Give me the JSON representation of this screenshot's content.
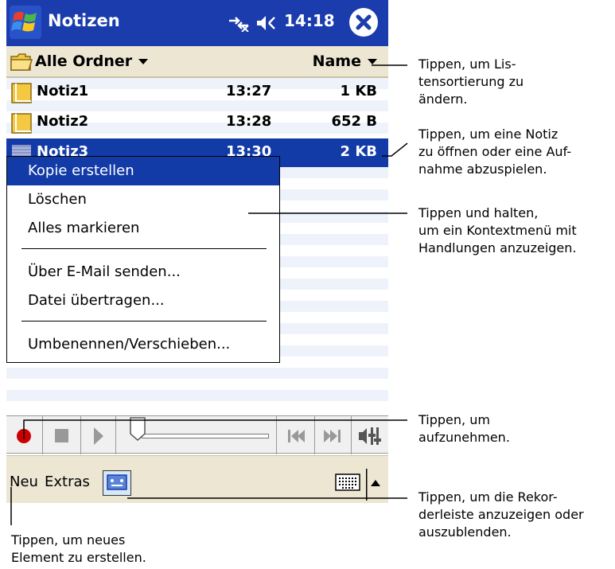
{
  "titlebar": {
    "app_title": "Notizen",
    "clock": "14:18",
    "icons": [
      "windows-start-icon",
      "connectivity-icon",
      "speaker-icon",
      "close-icon"
    ]
  },
  "header": {
    "folder_label": "Alle Ordner",
    "sort_label": "Name"
  },
  "files": [
    {
      "name": "Notiz1",
      "time": "13:27",
      "size": "1 KB",
      "icon": "note-icon"
    },
    {
      "name": "Notiz2",
      "time": "13:28",
      "size": "652 B",
      "icon": "note-icon"
    },
    {
      "name": "Notiz3",
      "time": "13:30",
      "size": "2 KB",
      "icon": "recording-icon",
      "selected": true
    }
  ],
  "context_menu": {
    "items": [
      "Kopie erstellen",
      "Löschen",
      "Alles markieren",
      "Über E-Mail senden...",
      "Datei übertragen...",
      "Umbenennen/Verschieben..."
    ],
    "active_index": 0
  },
  "recorder": {
    "icons": [
      "record-icon",
      "stop-icon",
      "play-icon",
      "seek-slider",
      "skip-back-icon",
      "skip-forward-icon",
      "volume-icon"
    ],
    "position": 0.0
  },
  "commandbar": {
    "new_label": "Neu",
    "tools_label": "Extras",
    "icons": [
      "recorder-toggle-icon",
      "keyboard-icon",
      "sip-arrow-icon"
    ]
  },
  "annotations": {
    "sort": [
      "Tippen, um Lis-",
      "tensortierung zu",
      "ändern."
    ],
    "open": [
      "Tippen, um eine Notiz",
      "zu öffnen oder eine Auf-",
      "nahme abzuspielen."
    ],
    "hold": [
      "Tippen und halten,",
      "um ein Kontextmenü mit",
      "Handlungen anzuzeigen."
    ],
    "record": [
      "Tippen, um",
      "aufzunehmen."
    ],
    "toolbar": [
      "Tippen, um die Rekor-",
      "derleiste anzuzeigen oder",
      "auszublenden."
    ],
    "new": [
      "Tippen, um neues",
      "Element zu erstellen."
    ]
  },
  "colors": {
    "titlebar": "#1a3cac",
    "selection": "#123ba8",
    "header": "#ece6d2",
    "list_stripe": "#eef3fb"
  }
}
